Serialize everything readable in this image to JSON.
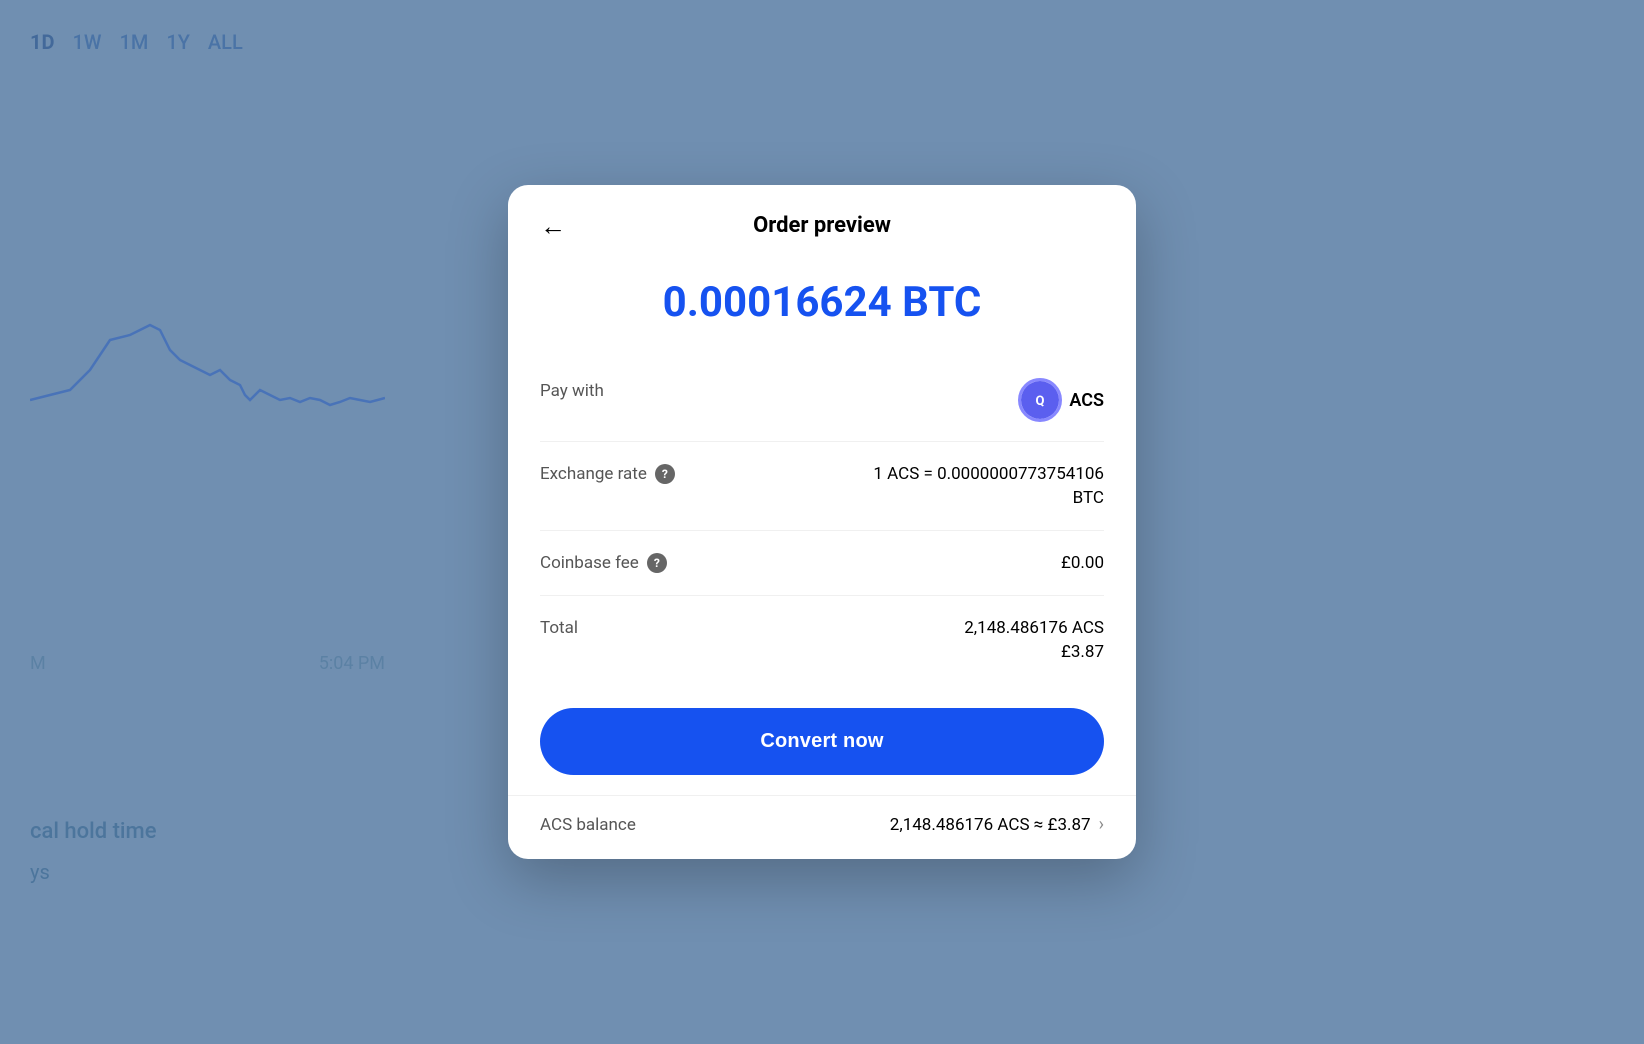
{
  "background": {
    "tabs": [
      "1D",
      "1W",
      "1M",
      "1Y",
      "ALL"
    ],
    "active_tab": "1D",
    "time_left": "M",
    "time_right": "5:04 PM",
    "hold_time_label": "cal hold time",
    "hold_time_info": "ℹ",
    "hold_days": "ys"
  },
  "modal": {
    "title": "Order preview",
    "back_label": "←",
    "btc_amount": "0.00016624 BTC",
    "pay_with_label": "Pay with",
    "pay_with_currency": "ACS",
    "exchange_rate_label": "Exchange rate",
    "exchange_rate_value_line1": "1 ACS = 0.0000000773754106",
    "exchange_rate_value_line2": "BTC",
    "coinbase_fee_label": "Coinbase fee",
    "coinbase_fee_value": "£0.00",
    "total_label": "Total",
    "total_value_line1": "2,148.486176 ACS",
    "total_value_line2": "£3.87",
    "convert_button": "Convert now",
    "balance_label": "ACS balance",
    "balance_value": "2,148.486176 ACS ≈ £3.87"
  },
  "colors": {
    "accent_blue": "#1652f0",
    "btc_blue": "#1652f0",
    "acs_purple": "#5b5fef"
  }
}
